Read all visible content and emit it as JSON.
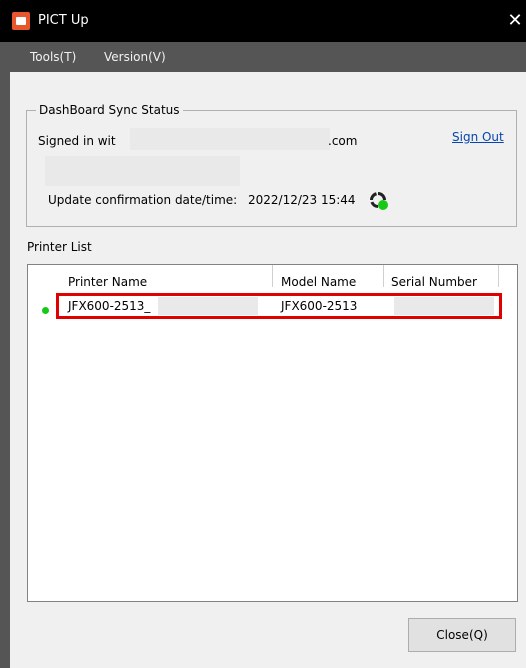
{
  "window": {
    "title": "PICT Up",
    "close_glyph": "✕"
  },
  "menu": {
    "items": [
      "Tools(T)",
      "Version(V)"
    ]
  },
  "sync_status": {
    "legend": "DashBoard Sync Status",
    "signed_in_prefix": "Signed in wit",
    "signed_in_suffix": ".com",
    "sign_out": "Sign Out",
    "update_label": "Update confirmation date/time:",
    "update_value": "2022/12/23 15:44",
    "sync_icon": "refresh-icon",
    "status_color": "#17c917"
  },
  "printer_list": {
    "label": "Printer List",
    "columns": [
      "Printer Name",
      "Model Name",
      "Serial Number"
    ],
    "rows": [
      {
        "printer_name": "JFX600-2513_",
        "model_name": "JFX600-2513",
        "serial_number": "",
        "status": "online"
      }
    ]
  },
  "buttons": {
    "close": "Close(Q)"
  },
  "colors": {
    "highlight": "#e00000",
    "app_icon": "#e8572b"
  }
}
